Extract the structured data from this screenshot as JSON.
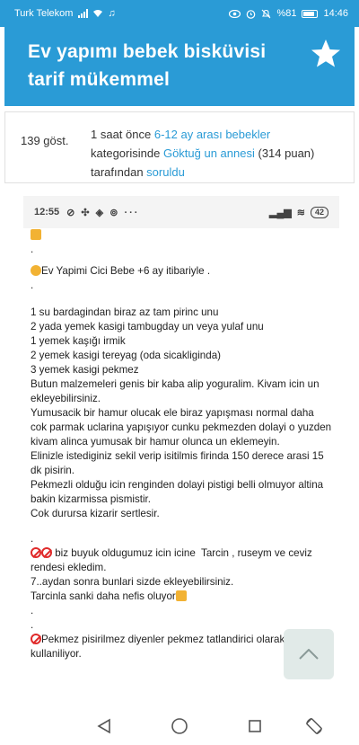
{
  "status_bar": {
    "carrier": "Turk Telekom",
    "battery": "%81",
    "time": "14:46"
  },
  "header": {
    "title": "Ev yapımı bebek bisküvisi tarif mükemmel",
    "star_icon": "star-icon"
  },
  "meta": {
    "views": "139 göst.",
    "time_ago": "1 saat önce",
    "category_link": "6-12 ay arası bebekler",
    "category_suffix": "kategorisinde",
    "author_link": "Göktuğ un annesi",
    "points": "(314 puan)",
    "by": "tarafından",
    "asked_link": "soruldu"
  },
  "embedded": {
    "time": "12:55",
    "battery": "42",
    "lines": [
      ".",
      "Ev Yapimi Cici Bebe +6 ay itibariyle .",
      ".",
      "",
      "1 su bardagindan biraz az tam pirinc unu",
      "2 yada yemek kasigi tambugday un veya yulaf unu",
      "1 yemek kaşığı irmik",
      "2 yemek kasigi tereyag (oda sicakliginda)",
      "3 yemek kasigi pekmez",
      "Butun malzemeleri genis bir kaba alip yoguralim. Kivam icin un ekleyebilirsiniz.",
      "Yumusacik bir hamur olucak ele biraz yapışması normal daha cok parmak uclarina yapışıyor cunku pekmezden dolayi o yuzden kivam alinca yumusak bir hamur olunca un eklemeyin.",
      "Elinizle istediginiz sekil verip isitilmis firinda 150 derece arasi 15 dk pisirin.",
      "Pekmezli olduğu icin renginden dolayi pistigi belli olmuyor altina bakin kizarmissa pismistir.",
      "Cok durursa kizarir sertlesir.",
      "",
      ".",
      " biz buyuk oldugumuz icin icine  Tarcin , ruseym ve ceviz rendesi ekledim.",
      "7..aydan sonra bunlari sizde ekleyebilirsiniz.",
      "Tarcinla sanki daha nefis oluyor",
      ".",
      ".",
      "Pekmez pisirilmez diyenler pekmez tatlandirici olarak kullaniliyor."
    ]
  },
  "navigation": {
    "back_icon": "back-triangle-icon",
    "home_icon": "home-circle-icon",
    "recents_icon": "recents-square-icon",
    "rotate_icon": "rotate-screen-icon"
  },
  "colors": {
    "brand": "#2a9bd6",
    "link": "#2a9bd6",
    "text": "#333333"
  }
}
